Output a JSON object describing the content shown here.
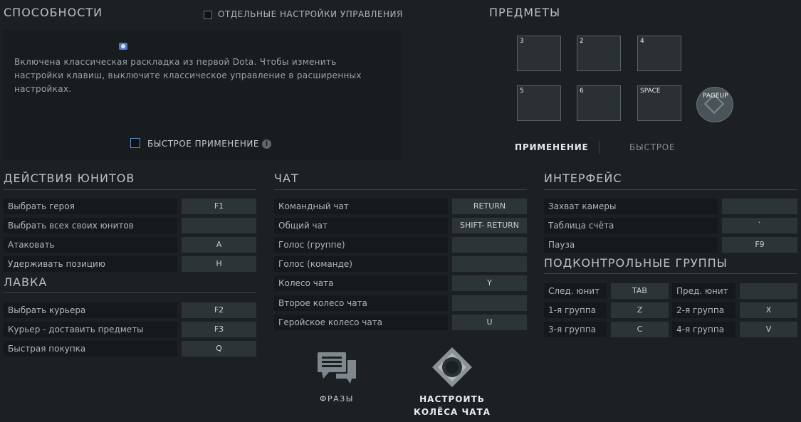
{
  "abilities": {
    "title": "СПОСОБНОСТИ",
    "separate_controls_label": "ОТДЕЛЬНЫЕ НАСТРОЙКИ УПРАВЛЕНИЯ",
    "info_text_1": "Включена классическая раскладка из первой Dota. Чтобы изменить",
    "info_text_2": "настройки клавиш, выключите классическое управление в расширенных",
    "info_text_3": "настройках.",
    "quick_cast_label": "БЫСТРОЕ ПРИМЕНЕНИЕ"
  },
  "items": {
    "title": "ПРЕДМЕТЫ",
    "slots": [
      "3",
      "2",
      "4",
      "5",
      "6",
      "SPACE"
    ],
    "pageup_label": "PAGEUP",
    "tab_apply": "ПРИМЕНЕНИЕ",
    "tab_quick": "БЫСТРОЕ"
  },
  "unit_actions": {
    "title": "ДЕЙСТВИЯ ЮНИТОВ",
    "rows": [
      {
        "label": "Выбрать героя",
        "key": "F1"
      },
      {
        "label": "Выбрать всех своих юнитов",
        "key": ""
      },
      {
        "label": "Атаковать",
        "key": "A"
      },
      {
        "label": "Удерживать позицию",
        "key": "H"
      }
    ]
  },
  "shop": {
    "title": "ЛАВКА",
    "rows": [
      {
        "label": "Выбрать курьера",
        "key": "F2"
      },
      {
        "label": "Курьер - доставить предметы",
        "key": "F3"
      },
      {
        "label": "Быстрая покупка",
        "key": "Q"
      }
    ]
  },
  "chat": {
    "title": "ЧАТ",
    "rows": [
      {
        "label": "Командный чат",
        "key": "RETURN"
      },
      {
        "label": "Общий чат",
        "key": "SHIFT- RETURN"
      },
      {
        "label": "Голос (группе)",
        "key": ""
      },
      {
        "label": "Голос (команде)",
        "key": ""
      },
      {
        "label": "Колесо чата",
        "key": "Y"
      },
      {
        "label": "Второе колесо чата",
        "key": ""
      },
      {
        "label": "Геройское колесо чата",
        "key": "U"
      }
    ],
    "phrases_label": "ФРАЗЫ",
    "configure_label_1": "НАСТРОИТЬ",
    "configure_label_2": "КОЛЁСА ЧАТА"
  },
  "interface": {
    "title": "ИНТЕРФЕЙС",
    "rows": [
      {
        "label": "Захват камеры",
        "key": ""
      },
      {
        "label": "Таблица счёта",
        "key": "`"
      },
      {
        "label": "Пауза",
        "key": "F9"
      }
    ]
  },
  "control_groups": {
    "title": "ПОДКОНТРОЛЬНЫЕ ГРУППЫ",
    "rows": [
      {
        "label_a": "След. юнит",
        "key_a": "TAB",
        "label_b": "Пред. юнит",
        "key_b": ""
      },
      {
        "label_a": "1-я группа",
        "key_a": "Z",
        "label_b": "2-я группа",
        "key_b": "X"
      },
      {
        "label_a": "3-я группа",
        "key_a": "C",
        "label_b": "4-я группа",
        "key_b": "V"
      }
    ]
  }
}
